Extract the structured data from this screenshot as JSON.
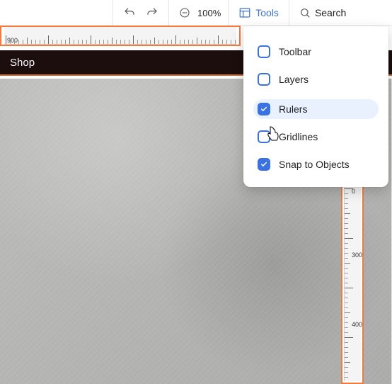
{
  "toolbar": {
    "undo_label": "Undo",
    "redo_label": "Redo",
    "zoom": "100%",
    "tools_label": "Tools",
    "search_label": "Search"
  },
  "shop": {
    "label": "Shop"
  },
  "tools_menu": {
    "items": [
      {
        "label": "Toolbar",
        "checked": false,
        "active": false
      },
      {
        "label": "Layers",
        "checked": false,
        "active": false
      },
      {
        "label": "Rulers",
        "checked": true,
        "active": true
      },
      {
        "label": "Gridlines",
        "checked": false,
        "active": false
      },
      {
        "label": "Snap to Objects",
        "checked": true,
        "active": false
      }
    ]
  },
  "ruler": {
    "h_start": 900,
    "v_marks": [
      0,
      300,
      400
    ]
  },
  "colors": {
    "accent": "#3b72e3",
    "highlight": "#f77a3d"
  }
}
